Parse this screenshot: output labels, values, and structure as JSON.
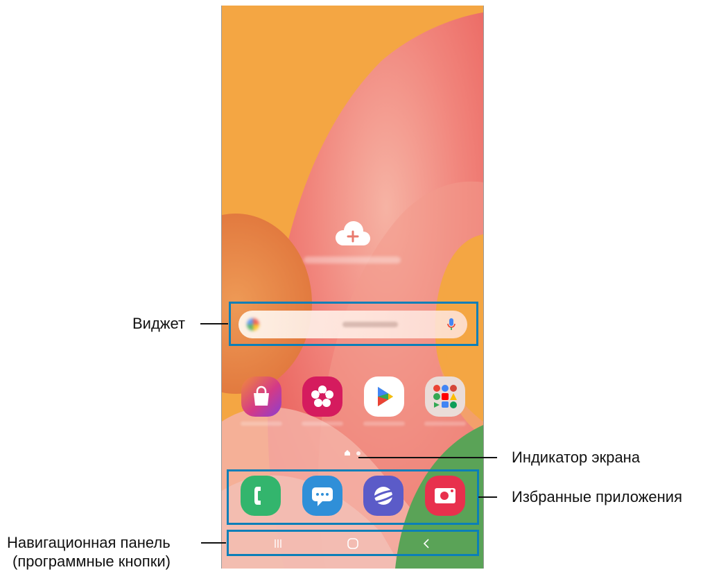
{
  "callouts": {
    "widget": "Виджет",
    "page_indicator": "Индикатор экрана",
    "favorite_apps": "Избранные приложения",
    "navigation_bar_line1": "Навигационная панель",
    "navigation_bar_line2": "(программные кнопки)"
  },
  "home_screen": {
    "search_widget": {
      "mic_icon": "microphone-icon",
      "logo_icon": "google-logo-icon"
    },
    "add_account_icon": "cloud-plus-icon",
    "apps": [
      {
        "name": "galaxy-store",
        "icon": "shopping-bag-icon",
        "color": "#d43a86"
      },
      {
        "name": "gallery",
        "icon": "flower-icon",
        "color": "#d51b5e"
      },
      {
        "name": "play-store",
        "icon": "play-triangle-icon",
        "color": "#ffffff"
      },
      {
        "name": "google-folder",
        "icon": "folder-grid-icon",
        "color": "#e8dcd8"
      }
    ],
    "page_indicator": {
      "pages": 2,
      "current": 1
    },
    "dock": [
      {
        "name": "phone",
        "icon": "phone-icon",
        "color": "#33b56d"
      },
      {
        "name": "messages",
        "icon": "chat-bubble-icon",
        "color": "#2f8fd8"
      },
      {
        "name": "internet",
        "icon": "planet-icon",
        "color": "#5b5bc8"
      },
      {
        "name": "camera",
        "icon": "camera-icon",
        "color": "#e8304d"
      }
    ],
    "nav_buttons": [
      "recents-icon",
      "home-icon",
      "back-icon"
    ]
  },
  "colors": {
    "callout_border": "#0b7fb8",
    "wallpaper_base": "#f4a643",
    "wallpaper_pink": "#f07f77"
  }
}
